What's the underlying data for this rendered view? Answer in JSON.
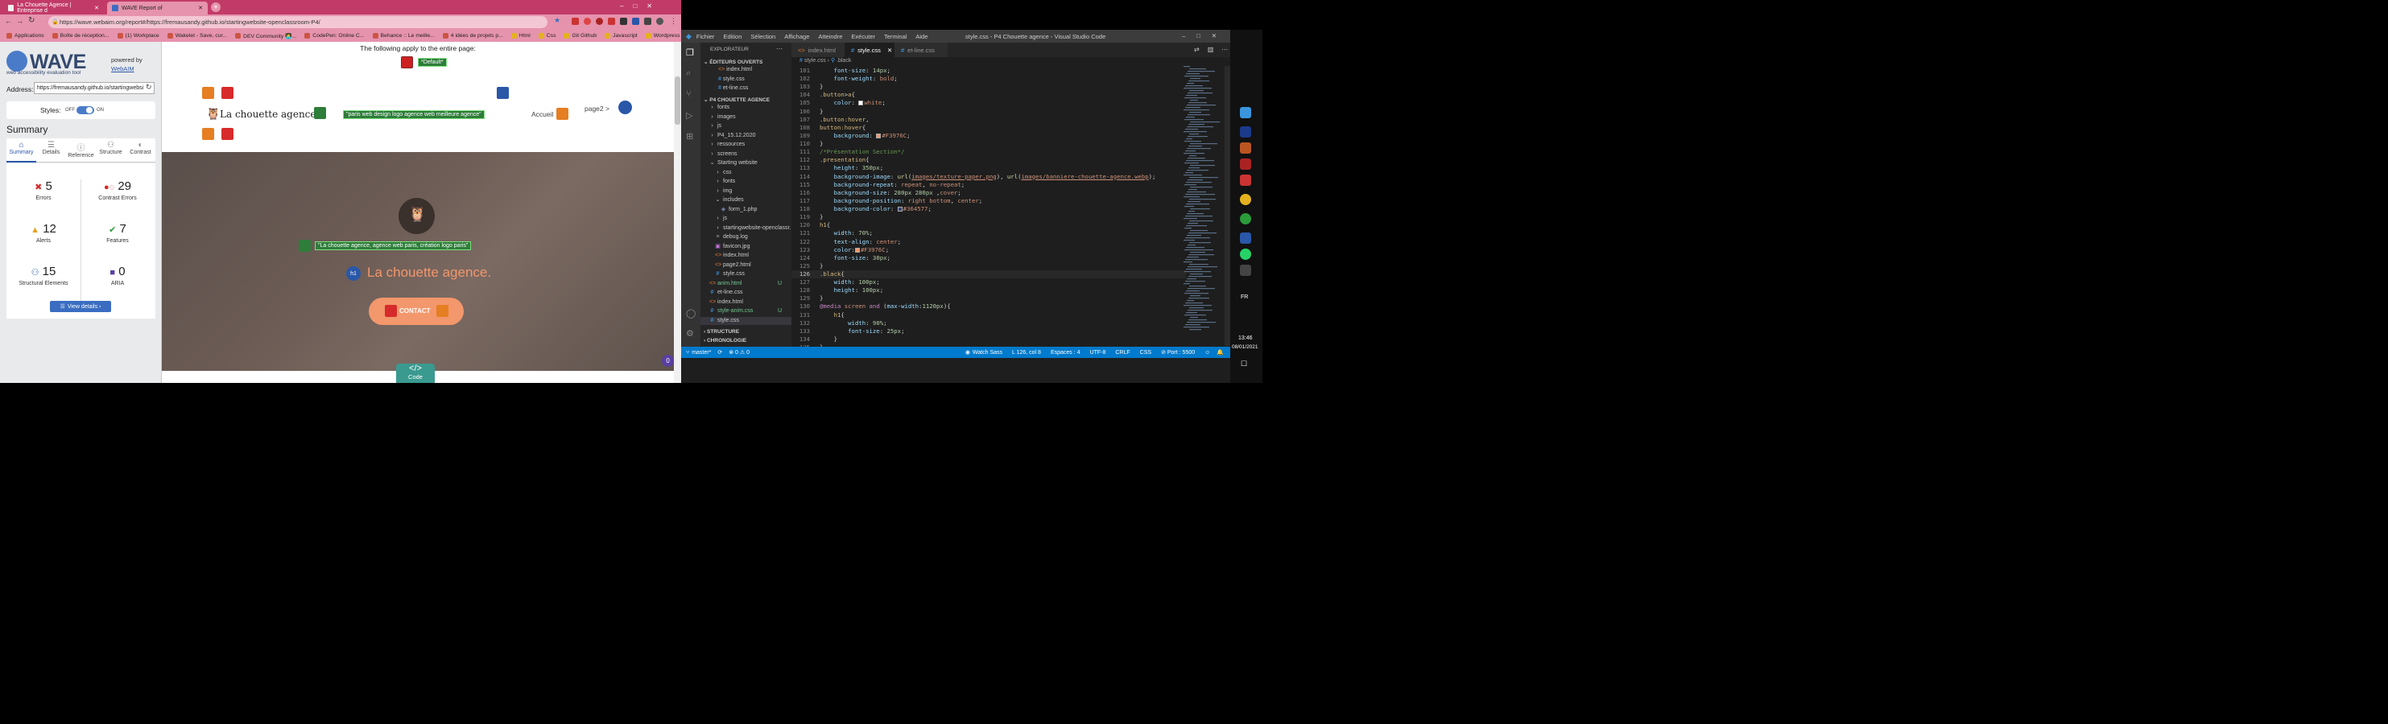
{
  "chrome": {
    "tabs": [
      {
        "title": "La Chouette Agence | Entreprise d",
        "active": false
      },
      {
        "title": "WAVE Report of",
        "active": true
      }
    ],
    "new_tab": "+",
    "url": "https://wave.webaim.org/report#/https://fremausandy.github.io/startingwebsite-openclassroom-P4/",
    "bookmarks": [
      "Applications",
      "Boîte de réception...",
      "(1) Workplace",
      "Wakelet - Save, cur...",
      "DEV Community 👩‍💻...",
      "CodePen: Online C...",
      "Behance :: Le meille...",
      "4 idées de projets p...",
      "Html",
      "Css",
      "Git Github",
      "Javascript",
      "Wordpress"
    ],
    "more": "»"
  },
  "wave": {
    "logo": "WAVE",
    "logo_sub": "web accessibility evaluation tool",
    "powered_by": "powered by",
    "webaim": "WebAIM",
    "address_label": "Address:",
    "address_value": "https://fremausandy.github.io/startingwebsi",
    "styles_label": "Styles:",
    "styles_off": "OFF",
    "styles_on": "ON",
    "summary_title": "Summary",
    "tabs": [
      "Summary",
      "Details",
      "Reference",
      "Structure",
      "Contrast"
    ],
    "stats": [
      {
        "value": "5",
        "label": "Errors",
        "color": "#d72b2b"
      },
      {
        "value": "29",
        "label": "Contrast Errors",
        "color": "#d72b2b"
      },
      {
        "value": "12",
        "label": "Alerts",
        "color": "#e6a11d"
      },
      {
        "value": "7",
        "label": "Features",
        "color": "#2a9c3a"
      },
      {
        "value": "15",
        "label": "Structural Elements",
        "color": "#3a6dc1"
      },
      {
        "value": "0",
        "label": "ARIA",
        "color": "#5a3fa3"
      }
    ],
    "view_details": "View details ›",
    "apply_text": "The following apply to the entire page:",
    "default_badge": "*Default*",
    "site_title": "La chouette agence",
    "alt_text_1": "\"paris web design logo agence web meilleure agence\"",
    "nav_accueil": "Accueil",
    "nav_page2": "page2 >",
    "alt_text_2": "\"La chouette agence, agence web paris, création logo paris\"",
    "h1_badge": "h1",
    "heading": "La chouette agence.",
    "contact": "CONTACT",
    "code_label": "Code",
    "code_glyph": "</>",
    "float_count": "0"
  },
  "vscode": {
    "menu": [
      "Fichier",
      "Edition",
      "Sélection",
      "Affichage",
      "Atteindre",
      "Exécuter",
      "Terminal",
      "Aide"
    ],
    "title": "style.css - P4 Chouette agence - Visual Studio Code",
    "explorer_title": "EXPLORATEUR",
    "open_editors": "ÉDITEURS OUVERTS",
    "open_files": [
      "index.html",
      "style.css",
      "et-line.css"
    ],
    "project": "P4 CHOUETTE AGENCE",
    "tree": [
      {
        "label": "fonts",
        "indent": 1,
        "type": "folder",
        "color": "#ccc"
      },
      {
        "label": "images",
        "indent": 1,
        "type": "folder",
        "color": "#ccc"
      },
      {
        "label": "js",
        "indent": 1,
        "type": "folder",
        "color": "#ccc"
      },
      {
        "label": "P4_15.12.2020",
        "indent": 1,
        "type": "folder",
        "color": "#ccc"
      },
      {
        "label": "ressources",
        "indent": 1,
        "type": "folder",
        "color": "#ccc"
      },
      {
        "label": "screens",
        "indent": 1,
        "type": "folder",
        "color": "#ccc"
      },
      {
        "label": "Starting website",
        "indent": 1,
        "type": "folder-open",
        "color": "#ccc"
      },
      {
        "label": "css",
        "indent": 2,
        "type": "folder",
        "color": "#ccc"
      },
      {
        "label": "fonts",
        "indent": 2,
        "type": "folder",
        "color": "#ccc"
      },
      {
        "label": "img",
        "indent": 2,
        "type": "folder",
        "color": "#ccc"
      },
      {
        "label": "includes",
        "indent": 2,
        "type": "folder-open",
        "color": "#ccc"
      },
      {
        "label": "form_1.php",
        "indent": 3,
        "type": "php",
        "color": "#ccc"
      },
      {
        "label": "js",
        "indent": 2,
        "type": "folder",
        "color": "#ccc"
      },
      {
        "label": "startingwebsite-openclassr...",
        "indent": 2,
        "type": "folder",
        "color": "#ccc"
      },
      {
        "label": "debug.log",
        "indent": 2,
        "type": "log",
        "color": "#ccc"
      },
      {
        "label": "favicon.jpg",
        "indent": 2,
        "type": "img",
        "color": "#ccc"
      },
      {
        "label": "index.html",
        "indent": 2,
        "type": "html",
        "color": "#ccc"
      },
      {
        "label": "page2.html",
        "indent": 2,
        "type": "html",
        "color": "#ccc"
      },
      {
        "label": "style.css",
        "indent": 2,
        "type": "css",
        "color": "#ccc"
      },
      {
        "label": "anim.html",
        "indent": 1,
        "type": "html",
        "color": "#73c991",
        "badge": "U"
      },
      {
        "label": "et-line.css",
        "indent": 1,
        "type": "css",
        "color": "#ccc"
      },
      {
        "label": "index.html",
        "indent": 1,
        "type": "html",
        "color": "#ccc"
      },
      {
        "label": "style-anim.css",
        "indent": 1,
        "type": "css",
        "color": "#73c991",
        "badge": "U"
      },
      {
        "label": "style.css",
        "indent": 1,
        "type": "css",
        "color": "#ccc",
        "selected": true
      }
    ],
    "structure": "STRUCTURE",
    "chronologie": "CHRONOLOGIE",
    "editor_tabs": [
      "index.html",
      "style.css",
      "et-line.css"
    ],
    "breadcrumb_file": "style.css",
    "breadcrumb_sel": ".black",
    "lines": [
      {
        "n": "101",
        "html": "    <span class=p>font-size</span>: <span class=n>14px</span>;"
      },
      {
        "n": "102",
        "html": "    <span class=p>font-weight</span>: <span class=v>bold</span>;"
      },
      {
        "n": "103",
        "html": "}"
      },
      {
        "n": "104",
        "html": "<span class=s>.button</span>&gt;<span class=s>a</span>{"
      },
      {
        "n": "105",
        "html": "    <span class=p>color</span>: <span class=sw style=\"background:#fff\"></span><span class=v>white</span>;"
      },
      {
        "n": "106",
        "html": "}"
      },
      {
        "n": "107",
        "html": "<span class=s>.button:hover</span>,"
      },
      {
        "n": "108",
        "html": "<span class=s>button:hover</span>{"
      },
      {
        "n": "109",
        "html": "    <span class=p>background</span>: <span class=sw style=\"background:#F3976C\"></span><span class=v>#F3976C</span>;"
      },
      {
        "n": "110",
        "html": "}"
      },
      {
        "n": "111",
        "html": "<span class=c>/*Présentation Section*/</span>"
      },
      {
        "n": "112",
        "html": "<span class=s>.presentation</span>{"
      },
      {
        "n": "113",
        "html": "    <span class=p>height</span>: <span class=n>350px</span>;"
      },
      {
        "n": "114",
        "html": "    <span class=p>background-image</span>: <span class=f>url</span>(<span class=u>images/texture-paper.png</span>), <span class=f>url</span>(<span class=u>images/banniere-chouette-agence.webp</span>);"
      },
      {
        "n": "115",
        "html": "    <span class=p>background-repeat</span>: <span class=v>repeat</span>, <span class=v>no-repeat</span>;"
      },
      {
        "n": "116",
        "html": "    <span class=p>background-size</span>: <span class=n>280px 280px</span> ,<span class=v>cover</span>;"
      },
      {
        "n": "117",
        "html": "    <span class=p>background-position</span>: <span class=v>right bottom</span>, <span class=v>center</span>;"
      },
      {
        "n": "118",
        "html": "    <span class=p>background-color</span>: <span class=sw style=\"background:#364577\"></span><span class=v>#364577</span>;"
      },
      {
        "n": "119",
        "html": "}"
      },
      {
        "n": "120",
        "html": "<span class=s>h1</span>{"
      },
      {
        "n": "121",
        "html": "    <span class=p>width</span>: <span class=n>70%</span>;"
      },
      {
        "n": "122",
        "html": "    <span class=p>text-align</span>: <span class=v>center</span>;"
      },
      {
        "n": "123",
        "html": "    <span class=p>color</span>:<span class=sw style=\"background:#F3976C\"></span><span class=v>#F3976C</span>;"
      },
      {
        "n": "124",
        "html": "    <span class=p>font-size</span>: <span class=n>30px</span>;"
      },
      {
        "n": "125",
        "html": "}"
      },
      {
        "n": "126",
        "html": "<span class=s>.black</span>{",
        "cur": true
      },
      {
        "n": "127",
        "html": "    <span class=p>width</span>: <span class=n>100px</span>;"
      },
      {
        "n": "128",
        "html": "    <span class=p>height</span>: <span class=n>100px</span>;"
      },
      {
        "n": "129",
        "html": "}"
      },
      {
        "n": "130",
        "html": "<span class=k>@media</span> <span class=v>screen</span> <span class=k>and</span> (<span class=p>max-width</span>:<span class=n>1120px</span>){"
      },
      {
        "n": "131",
        "html": "    <span class=s>h1</span>{"
      },
      {
        "n": "132",
        "html": "        <span class=p>width</span>: <span class=n>90%</span>;"
      },
      {
        "n": "133",
        "html": "        <span class=p>font-size</span>: <span class=n>25px</span>;"
      },
      {
        "n": "134",
        "html": "    }"
      },
      {
        "n": "135",
        "html": "}"
      }
    ],
    "status": {
      "branch": "master*",
      "sync": "⟳",
      "problems": "⊗ 0 ⚠ 0",
      "watch": "Watch Sass",
      "position": "L 126, col 8",
      "spaces": "Espaces : 4",
      "encoding": "UTF-8",
      "eol": "CRLF",
      "lang": "CSS",
      "port": "⊘ Port : 5500"
    }
  },
  "taskbar": {
    "lang": "FR",
    "time": "13:46",
    "date": "08/01/2021"
  },
  "colors": {
    "chrome_top": "#e8a0b4",
    "wave_panel": "#e9eaec",
    "vscode_bg": "#1e1e1e",
    "status": "#007acc"
  }
}
